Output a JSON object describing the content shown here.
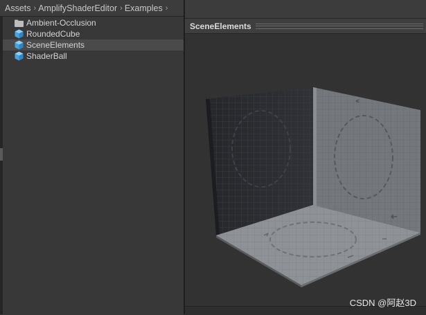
{
  "breadcrumb": {
    "items": [
      "Assets",
      "AmplifyShaderEditor",
      "Examples"
    ]
  },
  "project_list": {
    "items": [
      {
        "label": "Ambient-Occlusion",
        "icon": "folder-icon"
      },
      {
        "label": "RoundedCube",
        "icon": "prefab-cube-icon"
      },
      {
        "label": "SceneElements",
        "icon": "prefab-cube-icon",
        "selected": true
      },
      {
        "label": "ShaderBall",
        "icon": "prefab-cube-icon"
      }
    ]
  },
  "preview": {
    "title": "SceneElements",
    "scene": "corner-walls-and-floor-with-grid-texture"
  },
  "watermark": "CSDN @阿赵3D",
  "colors": {
    "prefab_icon": "#5fb4ea",
    "folder_icon": "#bdbdbd",
    "selected_row": "#4a4a4a"
  }
}
